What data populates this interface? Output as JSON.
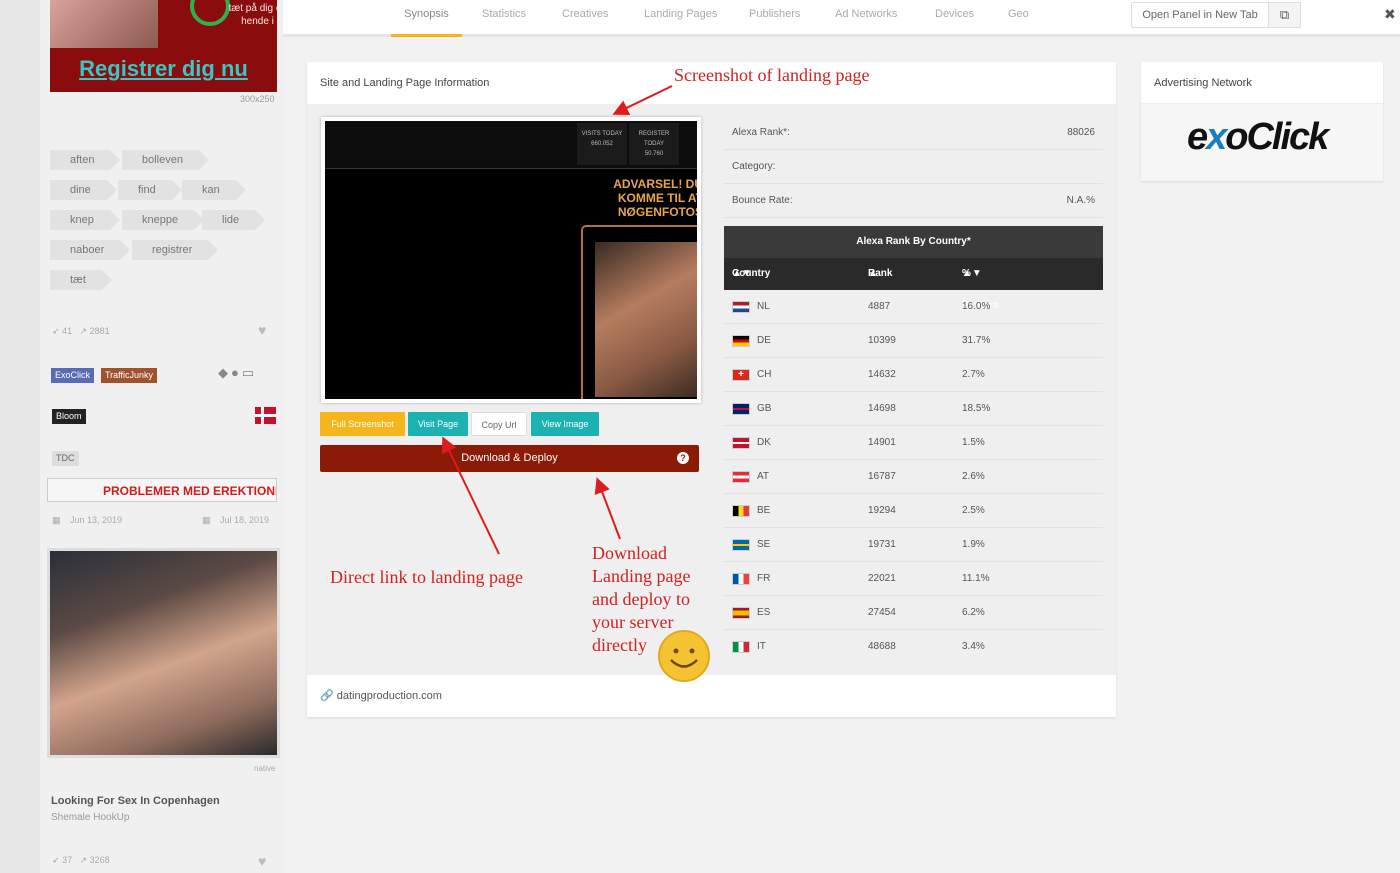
{
  "sidebar": {
    "ad": {
      "small_text": "tæt på dig og knep hende i aften",
      "cta": "Registrer dig nu",
      "size": "300x250"
    },
    "tags": [
      "aften",
      "bolleven",
      "dine",
      "find",
      "kan",
      "knep",
      "kneppe",
      "lide",
      "naboer",
      "registrer",
      "tæt"
    ],
    "stats": {
      "likes": "41",
      "views": "2881"
    },
    "networks": [
      "ExoClick",
      "TrafficJunky"
    ],
    "isp": "Bloom",
    "carrier": "TDC",
    "mini_ad": "PROBLEMER MED EREKTIONEN?",
    "dates": {
      "first": "Jun 13, 2019",
      "last": "Jul 18, 2019"
    },
    "native_label": "native",
    "card_title": "Looking For Sex In Copenhagen",
    "card_sub": "Shemale HookUp",
    "stats2": {
      "likes": "37",
      "views": "3268"
    }
  },
  "tabs": [
    "Synopsis",
    "Statistics",
    "Creatives",
    "Landing Pages",
    "Publishers",
    "Ad Networks",
    "Devices",
    "Geo"
  ],
  "active_tab": "Synopsis",
  "open_panel": "Open Panel in New Tab",
  "panel": {
    "title": "Site and Landing Page Information",
    "footer_domain": "datingproduction.com"
  },
  "screenshot": {
    "stat1": {
      "label": "VISITS TODAY",
      "value": "660.052"
    },
    "stat2": {
      "label": "REGISTER TODAY",
      "value": "50.760"
    },
    "warning": "ADVARSEL! DU KOMME TIL AT NØGENFOTOS"
  },
  "buttons": {
    "full": "Full Screenshot",
    "visit": "Visit Page",
    "copy": "Copy Url",
    "view": "View Image",
    "download": "Download & Deploy"
  },
  "info": {
    "alexa_rank_label": "Alexa Rank*:",
    "alexa_rank_value": "88026",
    "category_label": "Category:",
    "category_value": "",
    "bounce_label": "Bounce Rate:",
    "bounce_value": "N.A.%"
  },
  "alexa_table": {
    "title": "Alexa Rank By Country*",
    "headers": {
      "country": "Country",
      "rank": "Rank",
      "visitors": "% Visitors"
    },
    "rows": [
      {
        "country": "NL",
        "rank": "4887",
        "pct": "16.0%"
      },
      {
        "country": "DE",
        "rank": "10399",
        "pct": "31.7%"
      },
      {
        "country": "CH",
        "rank": "14632",
        "pct": "2.7%"
      },
      {
        "country": "GB",
        "rank": "14698",
        "pct": "18.5%"
      },
      {
        "country": "DK",
        "rank": "14901",
        "pct": "1.5%"
      },
      {
        "country": "AT",
        "rank": "16787",
        "pct": "2.6%"
      },
      {
        "country": "BE",
        "rank": "19294",
        "pct": "2.5%"
      },
      {
        "country": "SE",
        "rank": "19731",
        "pct": "1.9%"
      },
      {
        "country": "FR",
        "rank": "22021",
        "pct": "11.1%"
      },
      {
        "country": "ES",
        "rank": "27454",
        "pct": "6.2%"
      },
      {
        "country": "IT",
        "rank": "48688",
        "pct": "3.4%"
      }
    ]
  },
  "advertising": {
    "title": "Advertising Network",
    "logo_text": "exoClick"
  },
  "annotations": {
    "screenshot": "Screenshot of landing page",
    "direct_link": "Direct link to landing page",
    "download": "Download Landing page and deploy to your server directly"
  },
  "colors": {
    "accent_yellow": "#f5b51b",
    "accent_teal": "#1cb2b2",
    "download_red": "#8b1a06",
    "annotation_red": "#d22121"
  }
}
